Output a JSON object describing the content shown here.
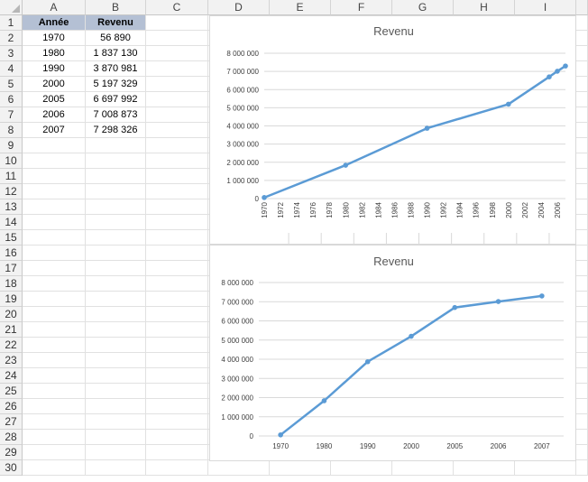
{
  "sheet": {
    "columns": [
      "A",
      "B",
      "C",
      "D",
      "E",
      "F",
      "G",
      "H",
      "I"
    ],
    "rows": [
      "1",
      "2",
      "3",
      "4",
      "5",
      "6",
      "7",
      "8",
      "9",
      "10",
      "11",
      "12",
      "13",
      "14",
      "15",
      "16",
      "17",
      "18",
      "19",
      "20",
      "21",
      "22",
      "23",
      "24",
      "25",
      "26",
      "27",
      "28",
      "29",
      "30"
    ],
    "header": {
      "year": "Année",
      "revenue": "Revenu"
    },
    "data": [
      {
        "year": "1970",
        "revenue": "56 890"
      },
      {
        "year": "1980",
        "revenue": "1 837 130"
      },
      {
        "year": "1990",
        "revenue": "3 870 981"
      },
      {
        "year": "2000",
        "revenue": "5 197 329"
      },
      {
        "year": "2005",
        "revenue": "6 697 992"
      },
      {
        "year": "2006",
        "revenue": "7 008 873"
      },
      {
        "year": "2007",
        "revenue": "7 298 326"
      }
    ]
  },
  "chart_data": [
    {
      "type": "line",
      "title": "Revenu",
      "x_axis": "date",
      "x": [
        1970,
        1980,
        1990,
        2000,
        2005,
        2006,
        2007
      ],
      "y": [
        56890,
        1837130,
        3870981,
        5197329,
        6697992,
        7008873,
        7298326
      ],
      "xticks": [
        "1970",
        "1972",
        "1974",
        "1976",
        "1978",
        "1980",
        "1982",
        "1984",
        "1986",
        "1988",
        "1990",
        "1992",
        "1994",
        "1996",
        "1998",
        "2000",
        "2002",
        "2004",
        "2006"
      ],
      "xlim": [
        1970,
        2007
      ],
      "yticks": [
        "0",
        "1 000 000",
        "2 000 000",
        "3 000 000",
        "4 000 000",
        "5 000 000",
        "6 000 000",
        "7 000 000",
        "8 000 000"
      ],
      "ylim": [
        0,
        8000000
      ],
      "grid": true,
      "color": "#5b9bd5"
    },
    {
      "type": "line",
      "title": "Revenu",
      "x_axis": "category",
      "categories": [
        "1970",
        "1980",
        "1990",
        "2000",
        "2005",
        "2006",
        "2007"
      ],
      "values": [
        56890,
        1837130,
        3870981,
        5197329,
        6697992,
        7008873,
        7298326
      ],
      "yticks": [
        "0",
        "1 000 000",
        "2 000 000",
        "3 000 000",
        "4 000 000",
        "5 000 000",
        "6 000 000",
        "7 000 000",
        "8 000 000"
      ],
      "ylim": [
        0,
        8000000
      ],
      "grid": true,
      "color": "#5b9bd5"
    }
  ]
}
